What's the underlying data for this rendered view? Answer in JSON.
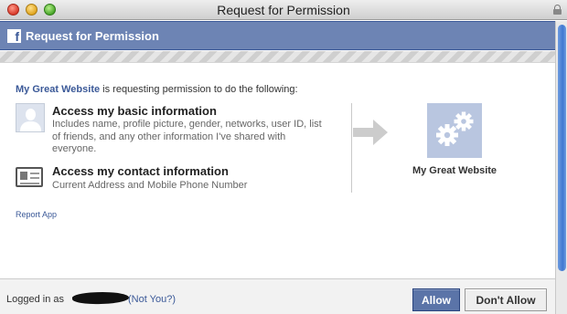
{
  "window": {
    "title": "Request for Permission"
  },
  "header": {
    "logo_letter": "f",
    "title": "Request for Permission"
  },
  "intro": {
    "site_name": "My Great Website",
    "text": " is requesting permission to do the following:"
  },
  "permissions": [
    {
      "icon": "user-silhouette-icon",
      "title": "Access my basic information",
      "description": "Includes name, profile picture, gender, networks, user ID, list of friends, and any other information I've shared with everyone."
    },
    {
      "icon": "contact-card-icon",
      "title": "Access my contact information",
      "description": "Current Address and Mobile Phone Number"
    }
  ],
  "app": {
    "icon": "gears-icon",
    "name": "My Great Website"
  },
  "report_link": "Report App",
  "footer": {
    "logged_in_label": "Logged in as",
    "not_you_link": "(Not You?)",
    "allow_button": "Allow",
    "deny_button": "Don't Allow"
  },
  "colors": {
    "header_bg": "#6d84b4",
    "link": "#3b5998",
    "allow_bg": "#5b74a8"
  }
}
